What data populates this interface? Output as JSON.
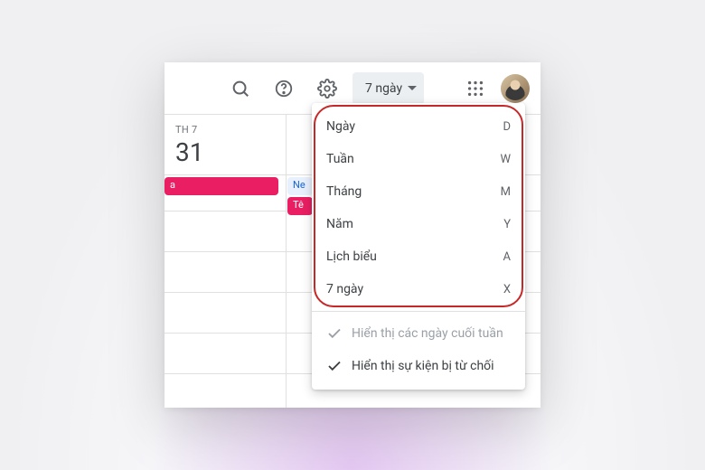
{
  "toolbar": {
    "view_label": "7 ngày"
  },
  "day": {
    "weekday": "TH 7",
    "num": "31"
  },
  "events": {
    "e1": "a",
    "e2": "Ne",
    "e3": "Tê"
  },
  "menu": {
    "items": [
      {
        "label": "Ngày",
        "key": "D"
      },
      {
        "label": "Tuần",
        "key": "W"
      },
      {
        "label": "Tháng",
        "key": "M"
      },
      {
        "label": "Năm",
        "key": "Y"
      },
      {
        "label": "Lịch biểu",
        "key": "A"
      },
      {
        "label": "7 ngày",
        "key": "X"
      }
    ],
    "show_weekends": "Hiển thị các ngày cuối tuần",
    "show_declined": "Hiển thị sự kiện bị từ chối"
  }
}
